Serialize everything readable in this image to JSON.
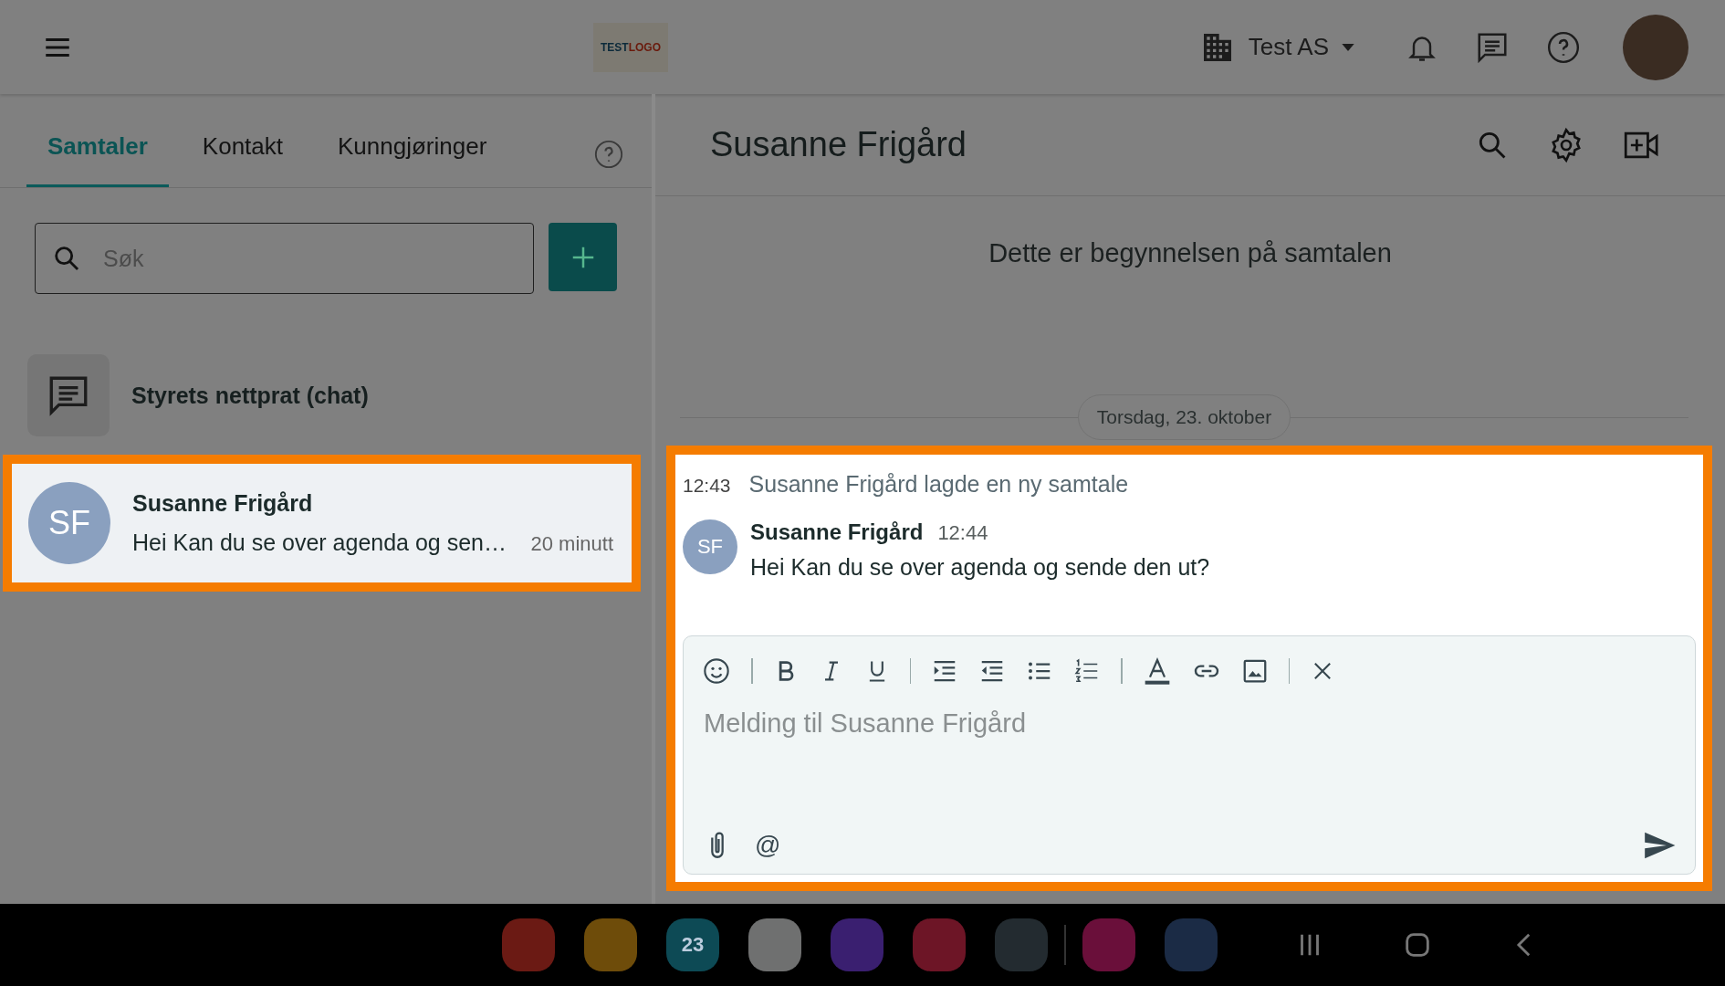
{
  "top_bar": {
    "logo": {
      "part_1": "TEST",
      "part_2": "LOGO"
    },
    "organization": "Test AS"
  },
  "tabs": [
    {
      "label": "Samtaler",
      "selected": true
    },
    {
      "label": "Kontakt",
      "selected": false
    },
    {
      "label": "Kunngjøringer",
      "selected": false
    }
  ],
  "search": {
    "placeholder": "Søk"
  },
  "conversations": [
    {
      "kind": "group",
      "name": "Styrets nettprat (chat)",
      "highlighted": false
    },
    {
      "kind": "person",
      "initials": "SF",
      "name": "Susanne Frigård",
      "preview": "Hei Kan du se over agenda og sen…",
      "time": "20 minutt",
      "highlighted": true
    }
  ],
  "chat": {
    "title": "Susanne Frigård",
    "start_note": "Dette er begynnelsen på samtalen",
    "date": "Torsdag, 23. oktober",
    "highlighted": true,
    "events": [
      {
        "kind": "system",
        "time": "12:43",
        "text": "Susanne Frigård lagde en ny samtale"
      },
      {
        "kind": "message",
        "initials": "SF",
        "author": "Susanne Frigård",
        "time": "12:44",
        "text": "Hei Kan du se over agenda og sende den ut?"
      }
    ],
    "composer": {
      "placeholder": "Melding til Susanne Frigård",
      "mention": "@"
    }
  },
  "taskbar": {
    "calendar_date": "23"
  }
}
